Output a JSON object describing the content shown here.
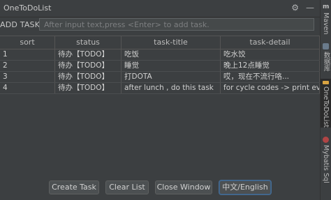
{
  "window": {
    "title": "OneToDoList"
  },
  "toolbar": {
    "add_label": "ADD TASK",
    "input_placeholder": "After input text,press <Enter> to add task."
  },
  "table": {
    "columns": [
      "sort",
      "status",
      "task-title",
      "task-detail"
    ],
    "rows": [
      [
        "1",
        "待办【TODO】",
        "吃饭",
        "吃水饺"
      ],
      [
        "2",
        "待办【TODO】",
        "睡觉",
        "晚上12点睡觉"
      ],
      [
        "3",
        "待办【TODO】",
        "打DOTA",
        "哎，现在不流行咯..."
      ],
      [
        "4",
        "待办【TODO】",
        "after lunch , do this task",
        "for cycle codes ->  print ever..."
      ]
    ]
  },
  "buttons": {
    "create": "Create Task",
    "clear": "Clear List",
    "close": "Close Window",
    "language": "中文/English"
  },
  "sidebar": {
    "tabs": [
      "Maven",
      "数据库",
      "OneToDoList",
      "Mybatis Sql"
    ]
  },
  "colors": {
    "background": "#3c3f41",
    "active_tab": "#2b2b2b",
    "focus": "#466d94"
  },
  "icons": {
    "settings": "gear-icon",
    "minimize": "minimize-icon"
  }
}
